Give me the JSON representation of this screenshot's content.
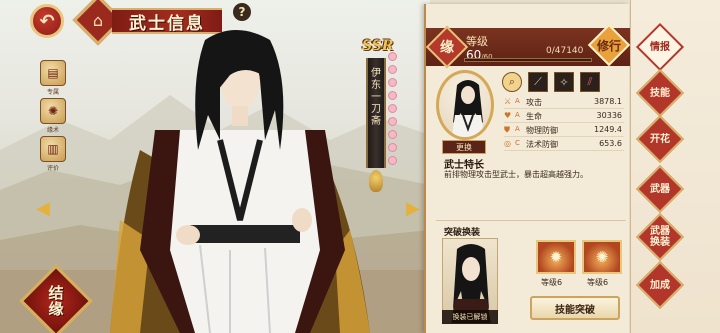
{
  "header": {
    "title": "武士信息",
    "help": "?"
  },
  "side_icons": [
    {
      "icon": "scroll-icon",
      "label": "专属"
    },
    {
      "icon": "compass-icon",
      "label": "缘术"
    },
    {
      "icon": "book-icon",
      "label": "评价"
    }
  ],
  "banner": {
    "rank": "SSR",
    "name": "伊东一刀斋"
  },
  "bond_button": {
    "line1": "结",
    "line2": "缘"
  },
  "info": {
    "yuan_badge": "缘",
    "level_label": "等级",
    "level": "60",
    "level_max": "/60",
    "exp": "0/47140",
    "exp_fraction": 0,
    "repair_button": "修行",
    "swap_button": "更换",
    "stats": [
      {
        "grade": "A",
        "name": "攻击",
        "value": "3878.1"
      },
      {
        "grade": "A",
        "name": "生命",
        "value": "30336"
      },
      {
        "grade": "A",
        "name": "物理防御",
        "value": "1249.4"
      },
      {
        "grade": "C",
        "name": "法术防御",
        "value": "653.6"
      }
    ],
    "trait_title": "武士特长",
    "trait_desc": "前排物理攻击型武士，暴击超高越强力。",
    "break_title": "突破换装",
    "break_caption": "换装已解锁",
    "skills": [
      {
        "label": "等级6"
      },
      {
        "label": "等级6"
      }
    ],
    "skill_break_button": "技能突破"
  },
  "tabs": [
    {
      "label": "情报",
      "active": true
    },
    {
      "label": "技能",
      "active": false
    },
    {
      "label": "开花",
      "active": false
    },
    {
      "label": "武器",
      "active": false
    },
    {
      "label": "武器换装",
      "active": false
    },
    {
      "label": "加成",
      "active": false
    }
  ],
  "colors": {
    "accent_red": "#b3362a",
    "gold": "#d8b06a",
    "panel_bg": "#f3ead7"
  }
}
